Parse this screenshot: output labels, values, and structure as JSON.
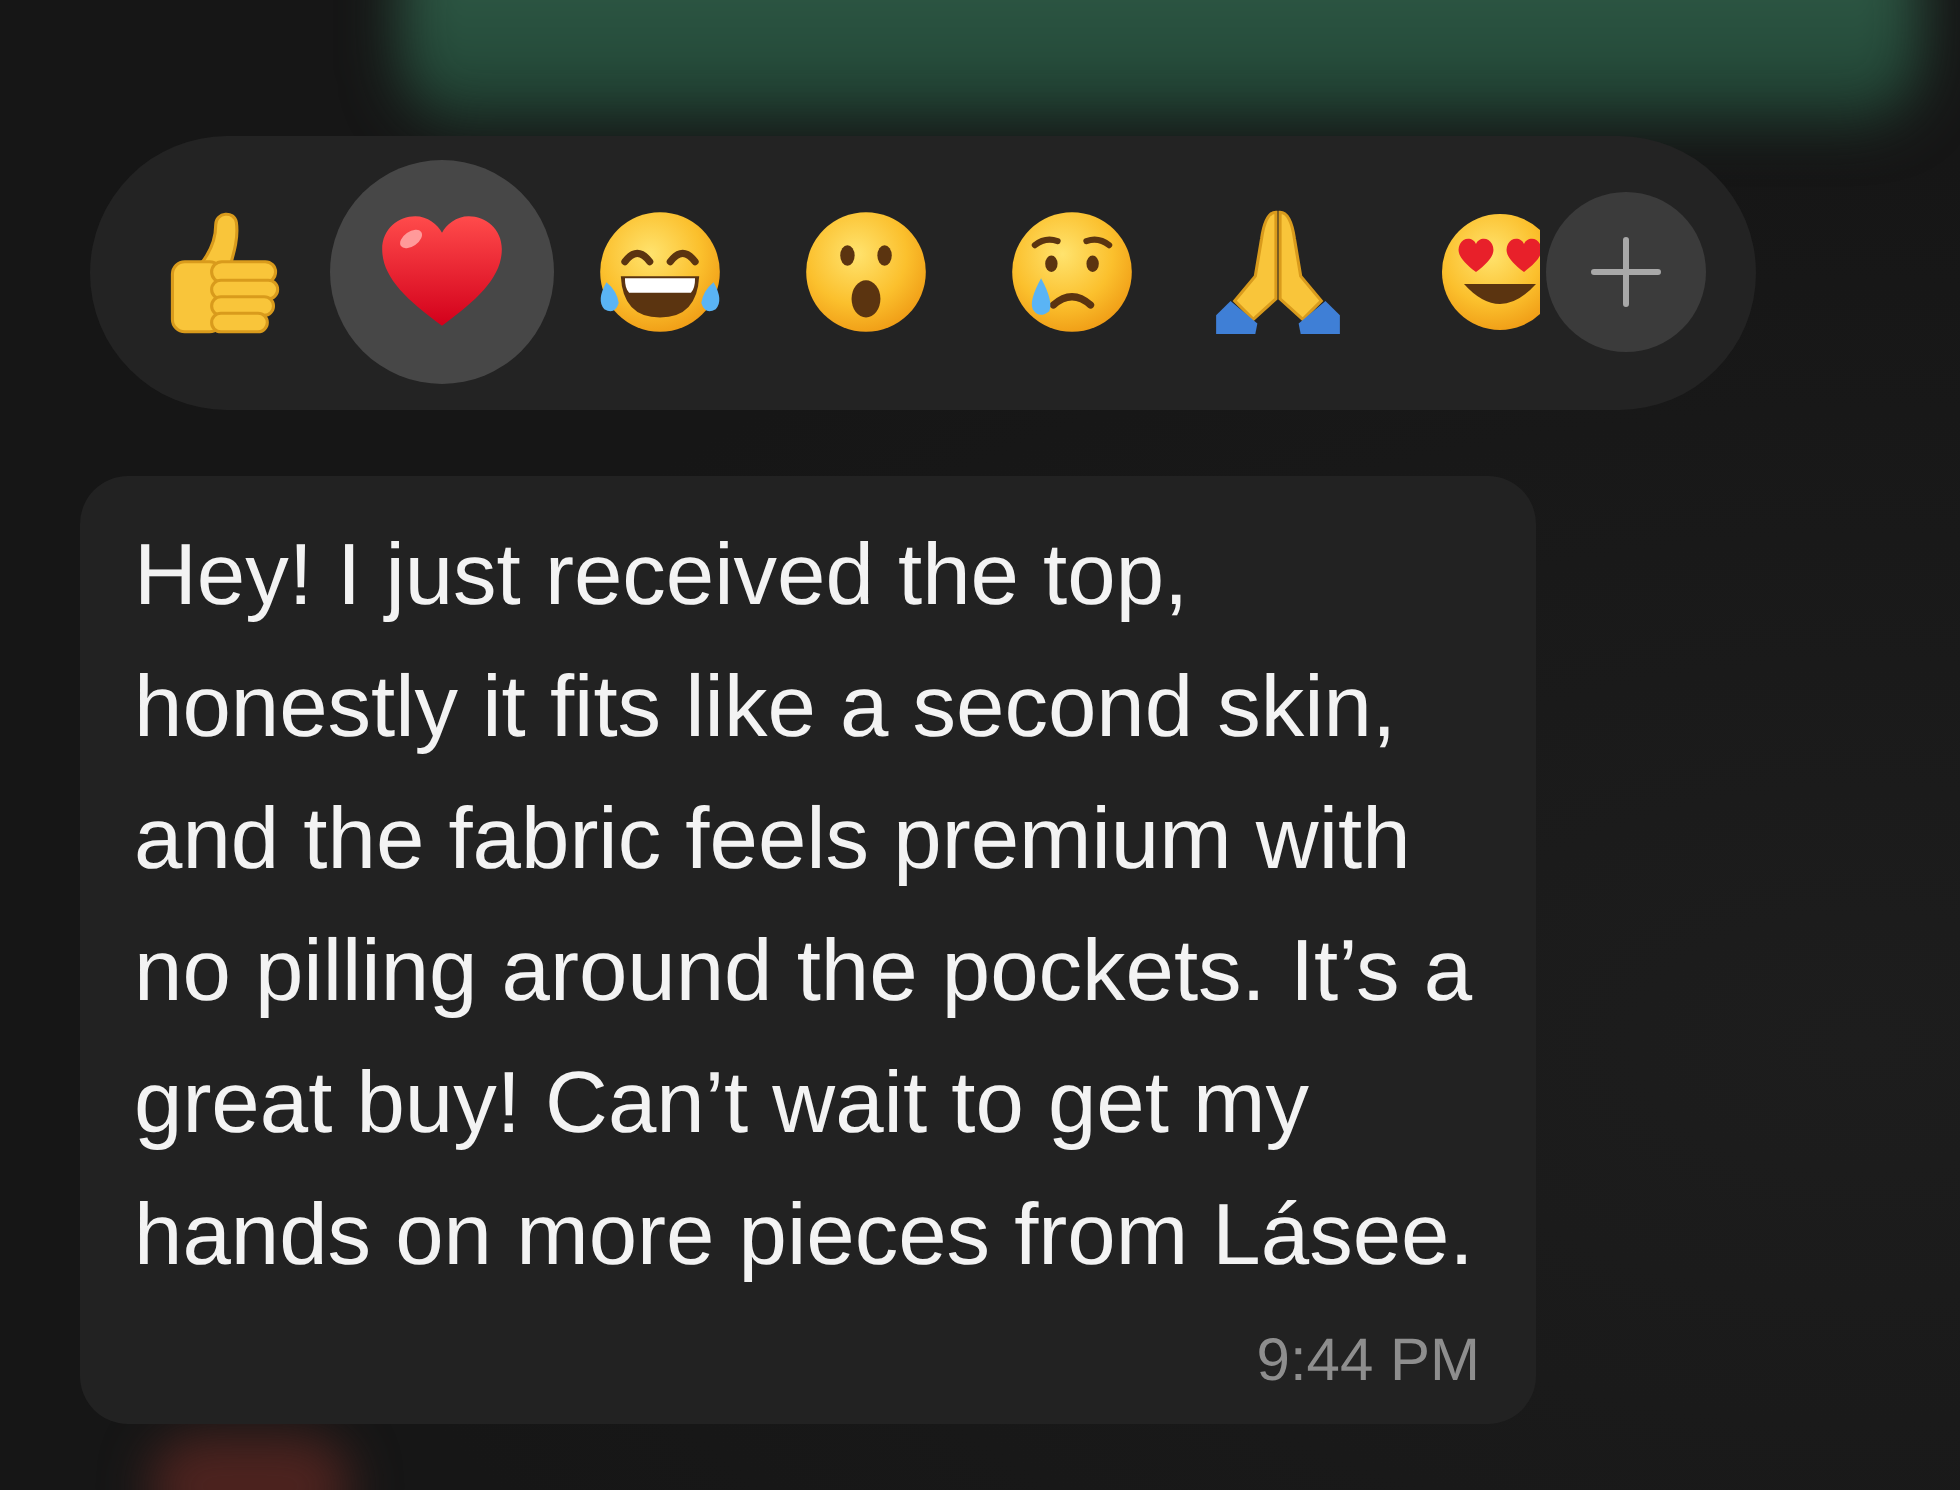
{
  "reaction_bar": {
    "reactions": [
      {
        "kind": "thumbs-up",
        "selected": false,
        "clipped": false
      },
      {
        "kind": "heart",
        "selected": true,
        "clipped": false
      },
      {
        "kind": "tears-of-joy",
        "selected": false,
        "clipped": false
      },
      {
        "kind": "surprised",
        "selected": false,
        "clipped": false
      },
      {
        "kind": "crying",
        "selected": false,
        "clipped": false
      },
      {
        "kind": "folded-hands",
        "selected": false,
        "clipped": false
      },
      {
        "kind": "heart-eyes",
        "selected": false,
        "clipped": true
      }
    ]
  },
  "message": {
    "text": "Hey! I just received the top,\nhonestly it fits like a second skin,\nand the fabric feels premium with\nno pilling around the pockets. It’s a\ngreat buy! Can’t wait to get my\nhands on more pieces from Lásee.",
    "time": "9:44 PM"
  }
}
